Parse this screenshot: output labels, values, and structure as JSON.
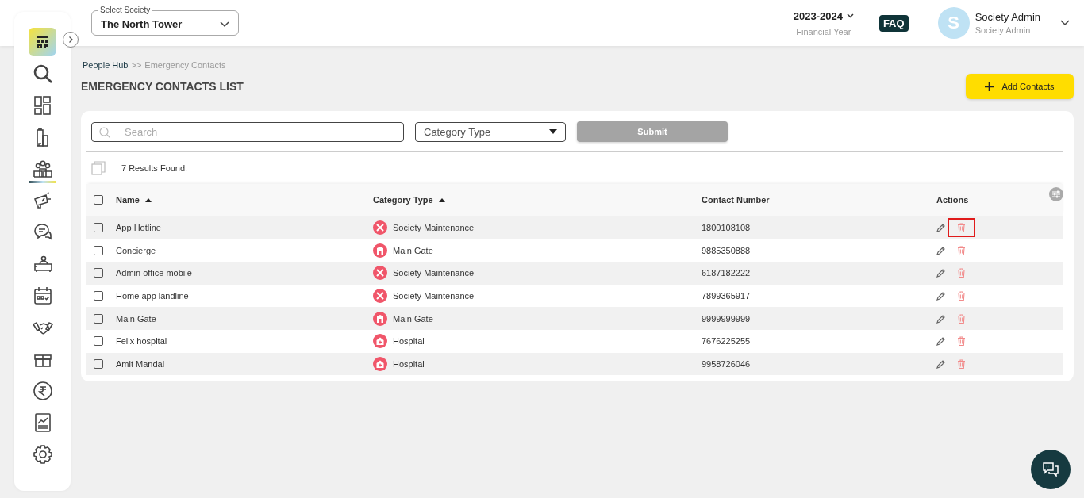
{
  "sidebar": {
    "items": [
      {
        "kind": "search",
        "selected": false
      },
      {
        "kind": "dashboard",
        "selected": false
      },
      {
        "kind": "building",
        "selected": false
      },
      {
        "kind": "people",
        "selected": true
      },
      {
        "kind": "megaphone",
        "selected": false
      },
      {
        "kind": "chat",
        "selected": false
      },
      {
        "kind": "reception",
        "selected": false
      },
      {
        "kind": "calendar",
        "selected": false
      },
      {
        "kind": "handshake",
        "selected": false
      },
      {
        "kind": "box",
        "selected": false
      },
      {
        "kind": "rupee",
        "selected": false
      },
      {
        "kind": "report",
        "selected": false
      },
      {
        "kind": "settings",
        "selected": false
      }
    ]
  },
  "header": {
    "society_label": "Select Society",
    "society_value": "The North Tower",
    "year": "2023-2024",
    "year_label": "Financial Year",
    "faq": "FAQ",
    "avatar_letter": "S",
    "user_name": "Society Admin",
    "user_role": "Society Admin"
  },
  "breadcrumb": {
    "parent": "People Hub",
    "separator": ">>",
    "current": "Emergency Contacts"
  },
  "page_title": "EMERGENCY CONTACTS LIST",
  "add_button": "Add Contacts",
  "filters": {
    "search_placeholder": "Search",
    "category_placeholder": "Category Type",
    "submit": "Submit"
  },
  "results": "7 Results Found.",
  "table": {
    "select_all_checked": false,
    "columns": [
      {
        "label": "Name",
        "sortable": true
      },
      {
        "label": "Category Type",
        "sortable": true
      },
      {
        "label": "Contact Number",
        "sortable": false
      },
      {
        "label": "Actions",
        "sortable": false
      }
    ],
    "rows": [
      {
        "name": "App Hotline",
        "category": "Society Maintenance",
        "kind": "maintenance",
        "number": "1800108108",
        "checked": false,
        "delete_highlighted": true
      },
      {
        "name": "Concierge",
        "category": "Main Gate",
        "kind": "gate",
        "number": "9885350888",
        "checked": false,
        "delete_highlighted": false
      },
      {
        "name": "Admin office mobile",
        "category": "Society Maintenance",
        "kind": "maintenance",
        "number": "6187182222",
        "checked": false,
        "delete_highlighted": false
      },
      {
        "name": "Home app landline",
        "category": "Society Maintenance",
        "kind": "maintenance",
        "number": "7899365917",
        "checked": false,
        "delete_highlighted": false
      },
      {
        "name": "Main Gate",
        "category": "Main Gate",
        "kind": "gate",
        "number": "9999999999",
        "checked": false,
        "delete_highlighted": false
      },
      {
        "name": "Felix hospital",
        "category": "Hospital",
        "kind": "hospital",
        "number": "7676225255",
        "checked": false,
        "delete_highlighted": false
      },
      {
        "name": "Amit Mandal",
        "category": "Hospital",
        "kind": "hospital",
        "number": "9958726046",
        "checked": false,
        "delete_highlighted": false
      }
    ]
  }
}
